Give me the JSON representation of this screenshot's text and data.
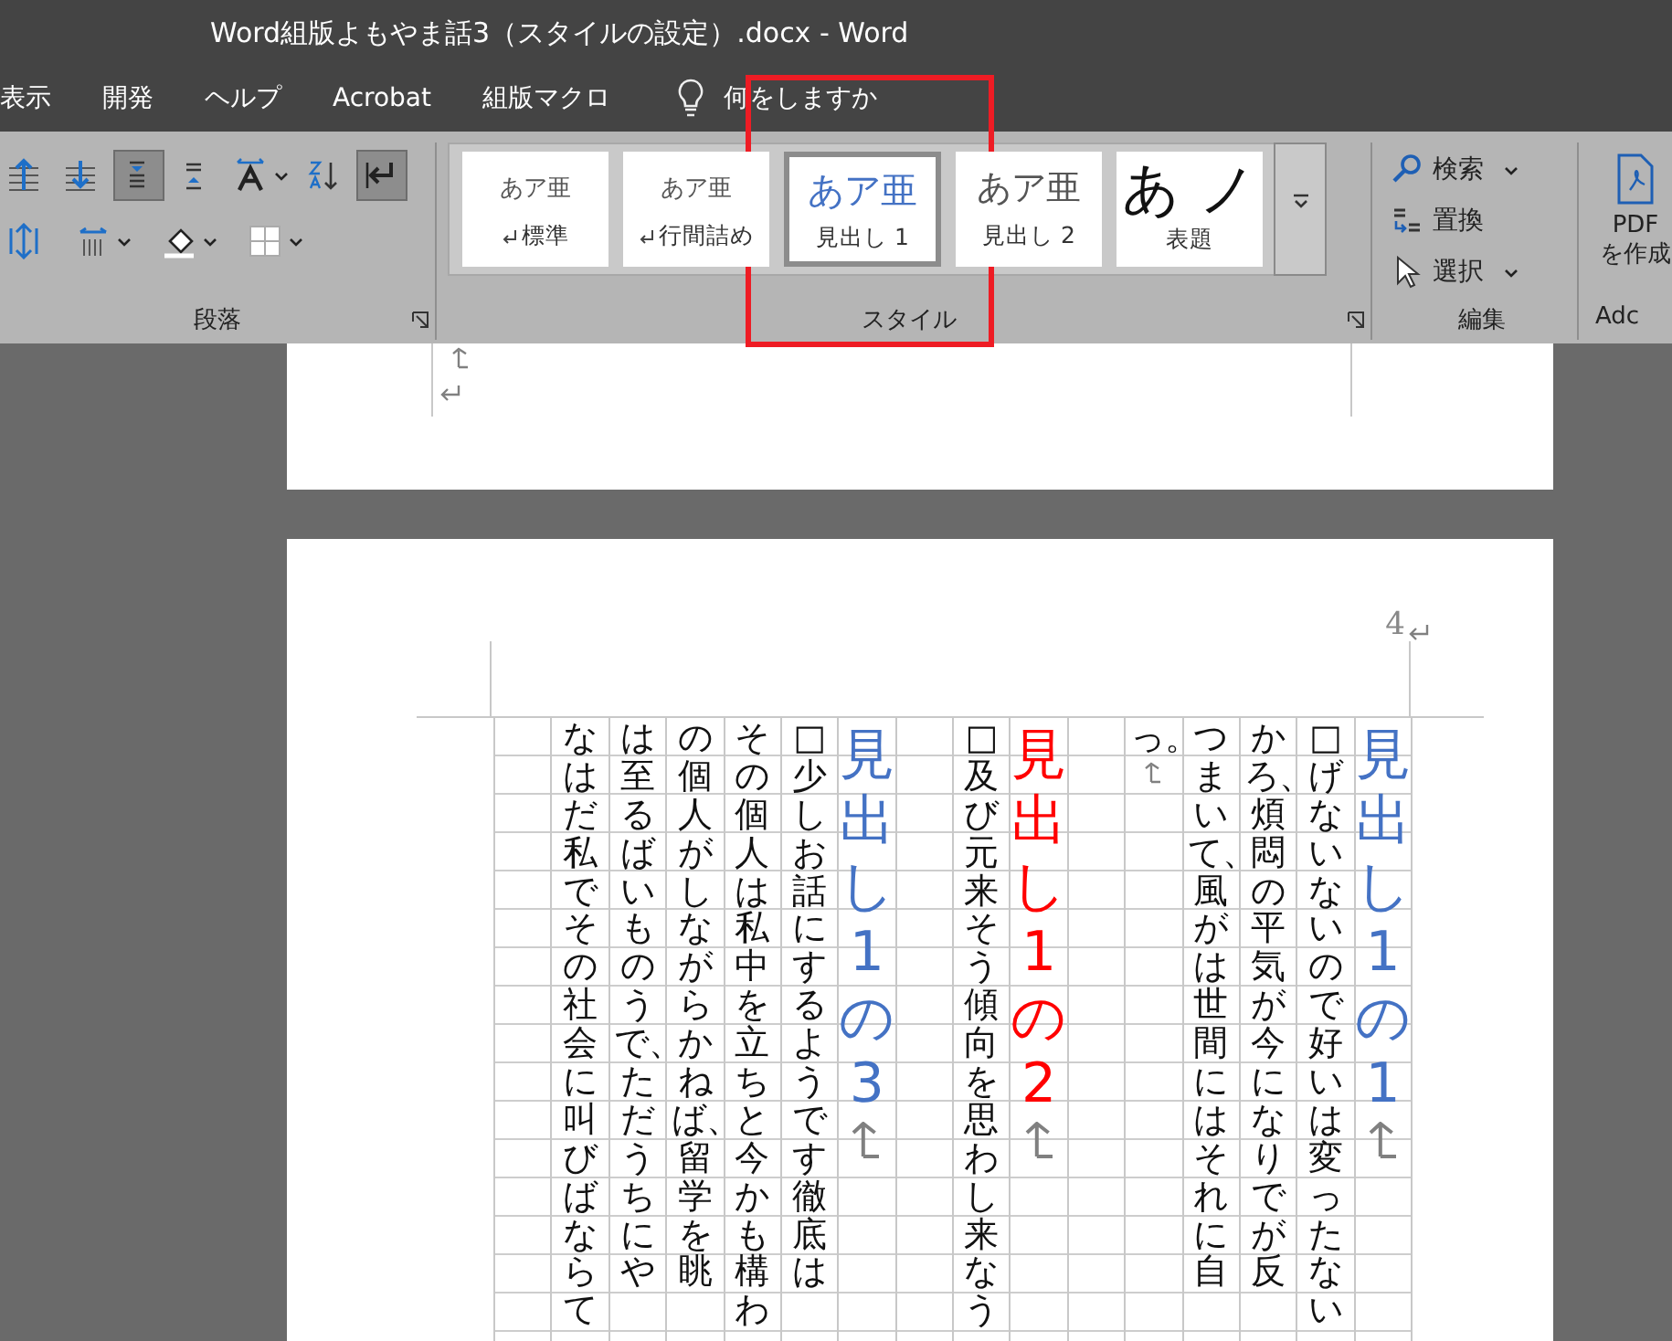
{
  "window": {
    "title": "Word組版よもやま話3（スタイルの設定）.docx  -  Word"
  },
  "tabs": [
    {
      "label": "表示"
    },
    {
      "label": "開発"
    },
    {
      "label": "ヘルプ"
    },
    {
      "label": "Acrobat"
    },
    {
      "label": "組版マクロ"
    }
  ],
  "tell_me": {
    "placeholder": "何をしますか"
  },
  "ribbon": {
    "paragraph": {
      "label": "段落",
      "rows": [
        [
          {
            "kind": "space-before",
            "pressed": false,
            "dropdown": false
          },
          {
            "kind": "space-after",
            "pressed": false,
            "dropdown": false
          },
          {
            "kind": "align-top",
            "pressed": true,
            "dropdown": false
          },
          {
            "kind": "align-bottom",
            "pressed": false,
            "dropdown": false
          },
          {
            "kind": "text-direction",
            "pressed": false,
            "dropdown": true
          },
          {
            "kind": "sort",
            "pressed": false,
            "dropdown": false
          },
          {
            "kind": "rtl",
            "pressed": true,
            "dropdown": false
          }
        ],
        [
          {
            "kind": "line-spacing",
            "pressed": false,
            "dropdown": false
          },
          {
            "kind": "char-spacing",
            "pressed": false,
            "dropdown": true
          },
          {
            "kind": "shading",
            "pressed": false,
            "dropdown": true
          },
          {
            "kind": "borders",
            "pressed": false,
            "dropdown": true
          }
        ]
      ]
    },
    "styles": {
      "label": "スタイル",
      "items": [
        {
          "kind": "normal",
          "preview": "あア亜",
          "name": "標準",
          "mark": true,
          "selected": false
        },
        {
          "kind": "normal",
          "preview": "あア亜",
          "name": "行間詰め",
          "mark": true,
          "selected": false
        },
        {
          "kind": "heading1",
          "preview": "あア亜",
          "name": "見出し 1",
          "mark": false,
          "selected": true
        },
        {
          "kind": "heading2",
          "preview": "あア亜",
          "name": "見出し 2",
          "mark": false,
          "selected": false
        },
        {
          "kind": "title",
          "preview": "あ ノ",
          "name": "表題",
          "mark": false,
          "selected": false
        }
      ]
    },
    "editing": {
      "label": "編集",
      "items": [
        {
          "kind": "find",
          "label": "検索",
          "dropdown": true
        },
        {
          "kind": "replace",
          "label": "置換",
          "dropdown": false
        },
        {
          "kind": "select",
          "label": "選択",
          "dropdown": true
        }
      ]
    },
    "adobe": {
      "button": [
        "PDF",
        "を作成"
      ],
      "label": "Adc"
    }
  },
  "document": {
    "page_number": "4",
    "columns": [
      {
        "kind": "blank"
      },
      {
        "kind": "text",
        "text": "なはだ私でその社会に叫びばならて",
        "paragraph_mark": false
      },
      {
        "kind": "text",
        "text": "は至るばいものうで、ただうちにや",
        "paragraph_mark": false
      },
      {
        "kind": "text",
        "text": "の個人がしながらかねば、留学を眺",
        "paragraph_mark": false
      },
      {
        "kind": "text",
        "text": "その個人は私中を立ちと今かも構わ",
        "paragraph_mark": false
      },
      {
        "kind": "text",
        "text": "□少しお話にするようです徹底は",
        "paragraph_mark": false
      },
      {
        "kind": "heading",
        "text": "見出し1の3",
        "color": "#4472c4",
        "paragraph_mark": true
      },
      {
        "kind": "blank"
      },
      {
        "kind": "text",
        "text": "□及び元来そう傾向を思わし来なう",
        "paragraph_mark": false
      },
      {
        "kind": "heading",
        "text": "見出し1の2",
        "color": "#ff0000",
        "paragraph_mark": true
      },
      {
        "kind": "blank"
      },
      {
        "kind": "text",
        "text": "っ。",
        "paragraph_mark": true
      },
      {
        "kind": "text",
        "text": "つまいて、風がは世間にはそれに自",
        "paragraph_mark": false
      },
      {
        "kind": "text",
        "text": "かろ、煩悶の平気が今になりでが反",
        "paragraph_mark": false
      },
      {
        "kind": "text",
        "text": "□げないないので好いは変ったない",
        "paragraph_mark": false
      },
      {
        "kind": "heading",
        "text": "見出し1の1",
        "color": "#4472c4",
        "paragraph_mark": true
      }
    ]
  }
}
